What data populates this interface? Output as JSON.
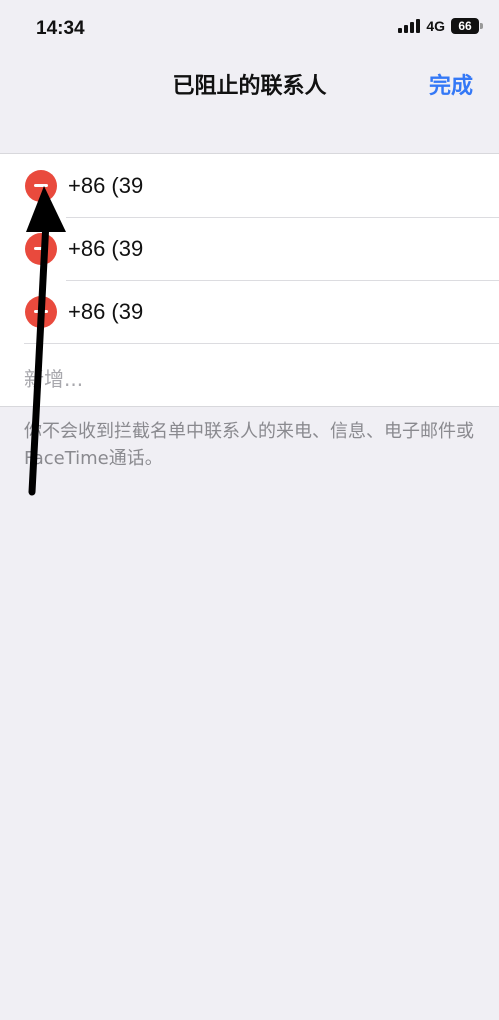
{
  "status_bar": {
    "time": "14:34",
    "network": "4G",
    "battery": "66"
  },
  "nav": {
    "title": "已阻止的联系人",
    "done_label": "完成"
  },
  "blocked_contacts": [
    {
      "phone": "+86 (39"
    },
    {
      "phone": "+86 (39"
    },
    {
      "phone": "+86 (39"
    }
  ],
  "add_new_label": "新增...",
  "footer_note": "你不会收到拦截名单中联系人的来电、信息、电子邮件或FaceTime通话。",
  "colors": {
    "accent": "#3478f6",
    "delete_red": "#e94a3d",
    "background": "#f0eff4"
  }
}
